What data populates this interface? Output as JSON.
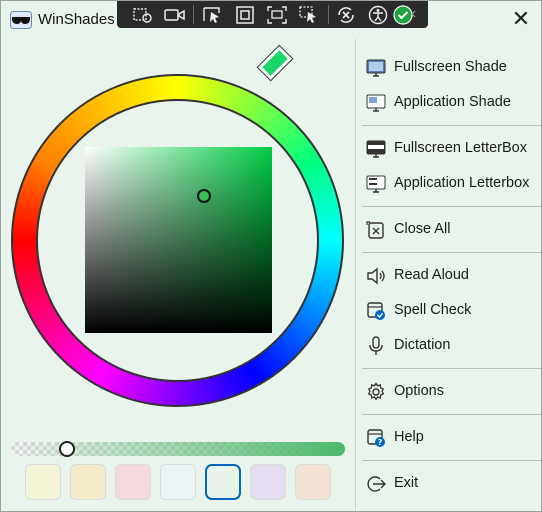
{
  "window": {
    "title": "WinShades",
    "close_glyph": "✕"
  },
  "toolbar": {
    "buttons": [
      "region-capture-icon",
      "video-record-icon",
      "cursor-select-icon",
      "stop-square-icon",
      "window-capture-icon",
      "repair-icon",
      "accessibility-icon",
      "check-circle-icon"
    ],
    "collapse_glyph": "‹"
  },
  "colors": {
    "accent": "#0066b8",
    "background": "#e9f5ec",
    "selected_color": "#3dbc5c",
    "hue_handle": "#19d86a"
  },
  "picker": {
    "alpha_percent": 15,
    "swatches": [
      {
        "color": "#f5f4d6",
        "selected": false
      },
      {
        "color": "#f5ecc9",
        "selected": false
      },
      {
        "color": "#f3d9de",
        "selected": false
      },
      {
        "color": "#ecf4f7",
        "selected": false
      },
      {
        "color": "#e8f4ea",
        "selected": true
      },
      {
        "color": "#e6dcef",
        "selected": false
      },
      {
        "color": "#f4e2d4",
        "selected": false
      }
    ]
  },
  "menu": {
    "fullscreen_shade": "Fullscreen Shade",
    "application_shade": "Application Shade",
    "fullscreen_letterbox": "Fullscreen LetterBox",
    "application_letterbox": "Application Letterbox",
    "close_all": "Close All",
    "read_aloud": "Read Aloud",
    "spell_check": "Spell Check",
    "dictation": "Dictation",
    "options": "Options",
    "help": "Help",
    "exit": "Exit"
  }
}
